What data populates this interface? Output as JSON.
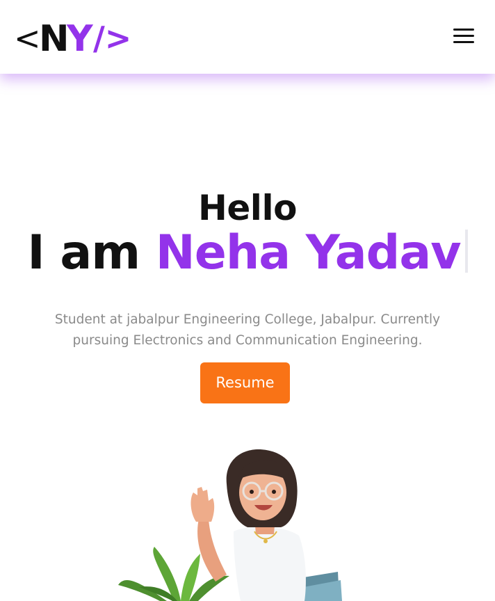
{
  "header": {
    "logo": {
      "open": "<",
      "initial1": "N",
      "initial2": "Y",
      "close": "/>"
    },
    "menu_icon": "hamburger-menu-icon"
  },
  "hero": {
    "greeting": "Hello",
    "intro_prefix": "I am ",
    "name": "Neha Yadav",
    "description": "Student at jabalpur Engineering College, Jabalpur. Currently pursuing Electronics and Communication Engineering.",
    "resume_label": "Resume",
    "illustration": "waving-girl-avatar-illustration"
  },
  "colors": {
    "accent_purple": "#9333ea",
    "button_orange": "#f97316",
    "text_dark": "#111111",
    "text_muted": "#8a8a8a"
  }
}
